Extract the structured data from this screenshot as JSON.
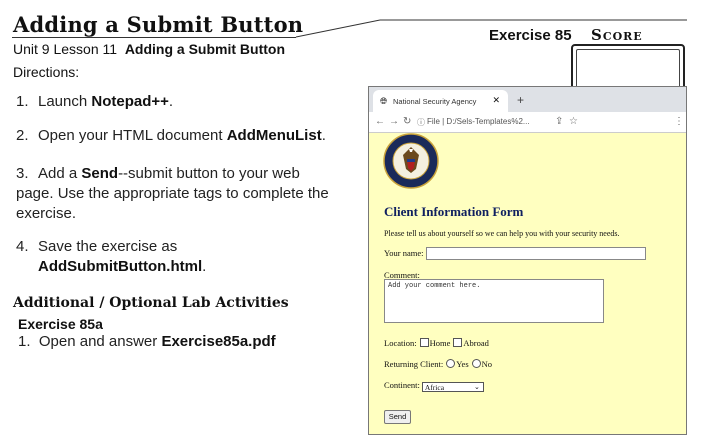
{
  "header": {
    "title": "Adding a Submit Button",
    "subtitle_prefix": "Unit 9 Lesson 11",
    "subtitle_bold": "Adding a Submit Button",
    "directions": "Directions:",
    "exercise": "Exercise 85",
    "score": "Score"
  },
  "steps": [
    {
      "num": "1.",
      "pre": "Launch ",
      "bold": "Notepad++",
      "post": "."
    },
    {
      "num": "2.",
      "pre": "Open your HTML document ",
      "bold": "AddMenuList",
      "post": "."
    },
    {
      "num": "3.",
      "pre": "Add a ",
      "bold": "Send",
      "post": "--submit button to your web page. Use the appropriate tags to complete the exercise."
    },
    {
      "num": "4.",
      "pre": "Save the exercise as ",
      "bold": "AddSubmitButton.html",
      "post": "."
    }
  ],
  "additional": {
    "heading": "Additional / Optional Lab Activities",
    "exercise": "Exercise 85a",
    "item_num": "1.",
    "item_pre": "Open and answer ",
    "item_bold": "Exercise85a.pdf"
  },
  "browser": {
    "tab_title": "National Security Agency",
    "url": "File | D:/Sels-Templates%2..."
  },
  "form": {
    "heading": "Client Information Form",
    "intro": "Please tell us about yourself so we can help you with your security needs.",
    "name_label": "Your name:",
    "comment_label": "Comment:",
    "comment_placeholder": "Add your comment here.",
    "location_label": "Location:",
    "home": "Home",
    "abroad": "Abroad",
    "returning_label": "Returning Client:",
    "yes": "Yes",
    "no": "No",
    "continent_label": "Continent:",
    "continent_value": "Africa",
    "send": "Send"
  }
}
